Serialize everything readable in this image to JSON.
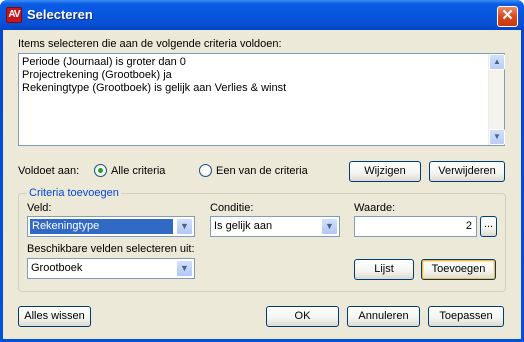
{
  "window": {
    "app_icon_text": "AV",
    "title": "Selecteren",
    "close_glyph": "✕"
  },
  "criteria_list": {
    "label": "Items selecteren die aan de volgende criteria voldoen:",
    "items": [
      "Periode (Journaal) is groter dan 0",
      "Projectrekening (Grootboek) ja",
      "Rekeningtype (Grootboek) is gelijk aan Verlies & winst"
    ]
  },
  "match": {
    "label": "Voldoet aan:",
    "options": [
      {
        "label": "Alle criteria",
        "checked": true
      },
      {
        "label": "Een van de criteria",
        "checked": false
      }
    ]
  },
  "buttons": {
    "change": "Wijzigen",
    "remove": "Verwijderen",
    "list": "Lijst",
    "add": "Toevoegen",
    "clear_all": "Alles wissen",
    "ok": "OK",
    "cancel": "Annuleren",
    "apply": "Toepassen",
    "ellipsis": "..."
  },
  "add_criteria": {
    "group_title": "Criteria toevoegen",
    "field_label": "Veld:",
    "field_value": "Rekeningtype",
    "condition_label": "Conditie:",
    "condition_value": "Is gelijk aan",
    "value_label": "Waarde:",
    "value": "2",
    "available_label": "Beschikbare velden selecteren uit:",
    "available_value": "Grootboek"
  },
  "icons": {
    "scroll_up": "▲",
    "scroll_down": "▼",
    "dropdown": "▼"
  }
}
